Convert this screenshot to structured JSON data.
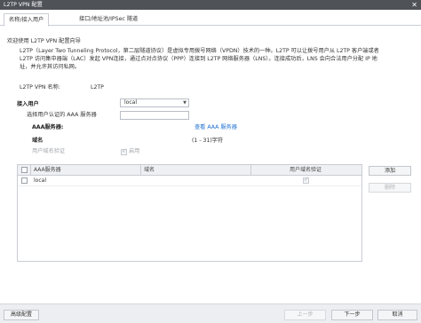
{
  "window": {
    "title": "L2TP VPN 配置",
    "close_glyph": "✕"
  },
  "tabs": [
    {
      "label": "名称/接入用户"
    },
    {
      "label": "接口/地址池/IPSec 隧道"
    }
  ],
  "intro": {
    "welcome": "欢迎使用 L2TP VPN 配置向导",
    "lines": [
      "L2TP（Layer Two Tunneling Protocol，第二层隧道协议）是虚拟专用拨号网络（VPDN）技术的一种。L2TP 可以让拨号用户从 L2TP 客户端或者",
      "L2TP 访问集中器端（LAC）发起 VPN连接，通过点对点协议（PPP）连接到 L2TP 网络服务器（LNS）。连接成功后，LNS 会向合法用户分配 IP 地",
      "址，并允许其访问私网。"
    ]
  },
  "vpn_name": {
    "label": "L2TP VPN 名称:",
    "value": "L2TP"
  },
  "access_user": {
    "section_title": "接入用户",
    "hint": "选择用户认证的 AAA 服务器",
    "aaa_label": "AAA服务器:",
    "aaa_selected": "local",
    "aaa_link": "查看 AAA 服务器",
    "domain_label": "域名",
    "domain_value": "",
    "domain_hint": "(1 - 31)字符",
    "domain_auth_label": "用户域名验证",
    "domain_auth_enable": "启用"
  },
  "table": {
    "columns": [
      "AAA服务器",
      "域名",
      "用户域名验证"
    ],
    "rows": [
      {
        "aaa": "local",
        "domain": "",
        "domain_auth": true
      }
    ],
    "add_label": "添加",
    "delete_label": "删除"
  },
  "footer": {
    "advanced_label": "高级配置",
    "prev_label": "上一步",
    "next_label": "下一步",
    "cancel_label": "取消"
  }
}
